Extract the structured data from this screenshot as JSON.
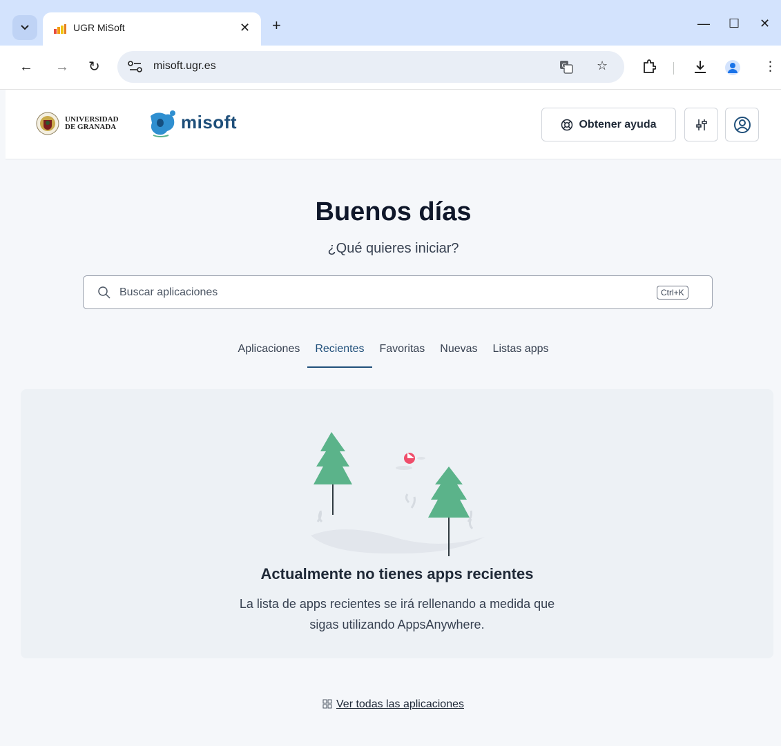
{
  "browser": {
    "tab_title": "UGR MiSoft",
    "url": "misoft.ugr.es",
    "icons": [
      "tab-search-icon",
      "close-icon",
      "new-tab-icon",
      "minimize-icon",
      "maximize-icon",
      "close-window-icon",
      "back-icon",
      "forward-icon",
      "reload-icon",
      "site-info-icon",
      "translate-icon",
      "bookmark-star-icon",
      "extensions-icon",
      "download-icon",
      "profile-icon",
      "menu-icon"
    ]
  },
  "header": {
    "ugr_line1": "UNIVERSIDAD",
    "ugr_line2": "DE GRANADA",
    "brand": "misoft",
    "help_label": "Obtener ayuda"
  },
  "main": {
    "greeting": "Buenos días",
    "subtitle": "¿Qué quieres iniciar?",
    "search_placeholder": "Buscar aplicaciones",
    "shortcut": "Ctrl+K",
    "tabs": [
      {
        "label": "Aplicaciones",
        "active": false
      },
      {
        "label": "Recientes",
        "active": true
      },
      {
        "label": "Favoritas",
        "active": false
      },
      {
        "label": "Nuevas",
        "active": false
      },
      {
        "label": "Listas apps",
        "active": false
      }
    ],
    "empty_title": "Actualmente no tienes apps recientes",
    "empty_description": "La lista de apps recientes se irá rellenando a medida que sigas utilizando AppsAnywhere.",
    "see_all_label": "Ver todas las aplicaciones"
  },
  "colors": {
    "accent": "#1f4f7a",
    "tree": "#5bb38a",
    "tabstrip": "#d3e3fd"
  }
}
